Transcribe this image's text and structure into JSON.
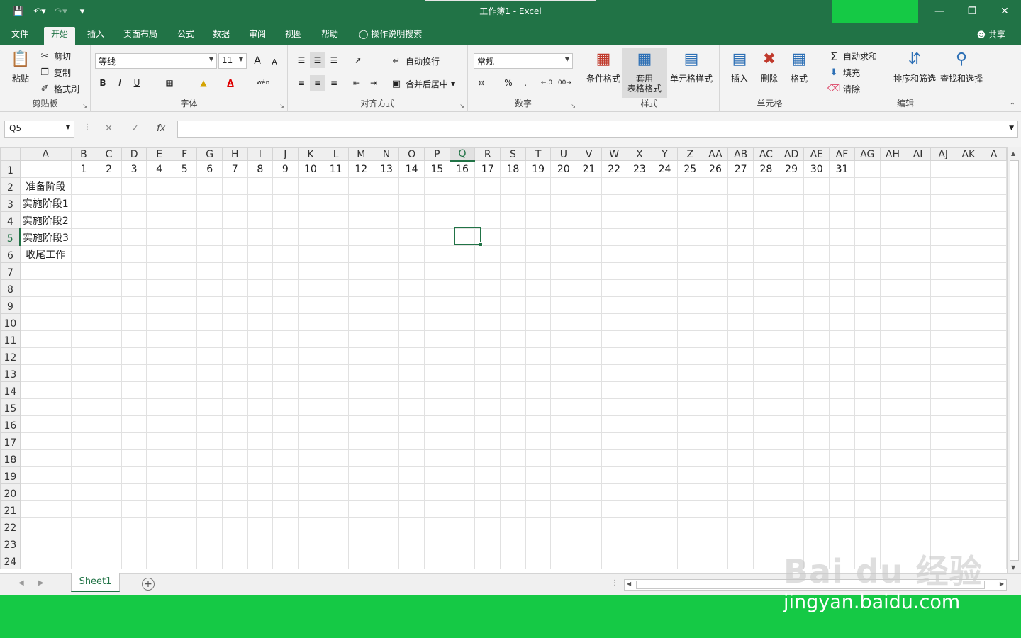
{
  "titlebar": {
    "title": "工作簿1  -  Excel",
    "qat": {
      "save_icon": "save-icon",
      "undo_icon": "undo-icon",
      "redo_icon": "redo-icon",
      "customize_icon": "customize-qat-icon"
    },
    "colors": {
      "excel_green": "#217346",
      "overlay_green": "#15c945"
    }
  },
  "tabs": {
    "items": [
      {
        "label": "文件"
      },
      {
        "label": "开始"
      },
      {
        "label": "插入"
      },
      {
        "label": "页面布局"
      },
      {
        "label": "公式"
      },
      {
        "label": "数据"
      },
      {
        "label": "审阅"
      },
      {
        "label": "视图"
      },
      {
        "label": "帮助"
      }
    ],
    "active": "开始",
    "tell_me": "操作说明搜索",
    "share": "共享"
  },
  "ribbon": {
    "clipboard": {
      "paste": "粘贴",
      "cut": "剪切",
      "copy": "复制",
      "format_painter": "格式刷",
      "label": "剪贴板"
    },
    "font": {
      "name": "等线",
      "size": "11",
      "label": "字体",
      "bold": "B",
      "italic": "I",
      "underline": "U",
      "grow": "A",
      "shrink": "A",
      "phonetic": "wén"
    },
    "alignment": {
      "wrap": "自动换行",
      "merge": "合并后居中",
      "label": "对齐方式"
    },
    "number": {
      "format": "常规",
      "label": "数字",
      "percent": "%",
      "comma": ","
    },
    "styles": {
      "conditional": "条件格式",
      "table_line1": "套用",
      "table_line2": "表格格式",
      "cell_styles": "单元格样式",
      "label": "样式"
    },
    "cells": {
      "insert": "插入",
      "delete": "删除",
      "format": "格式",
      "label": "单元格"
    },
    "editing": {
      "autosum": "自动求和",
      "fill": "填充",
      "clear": "清除",
      "sort": "排序和筛选",
      "find": "查找和选择",
      "label": "编辑"
    }
  },
  "formula_bar": {
    "name_box": "Q5",
    "cancel": "✕",
    "enter": "✓",
    "fx": "fx",
    "value": ""
  },
  "sheet": {
    "columns": [
      "A",
      "B",
      "C",
      "D",
      "E",
      "F",
      "G",
      "H",
      "I",
      "J",
      "K",
      "L",
      "M",
      "N",
      "O",
      "P",
      "Q",
      "R",
      "S",
      "T",
      "U",
      "V",
      "W",
      "X",
      "Y",
      "Z",
      "AA",
      "AB",
      "AC",
      "AD",
      "AE",
      "AF",
      "AG",
      "AH",
      "AI",
      "AJ",
      "AK",
      "A"
    ],
    "rows": [
      [
        "",
        "1",
        "2",
        "3",
        "4",
        "5",
        "6",
        "7",
        "8",
        "9",
        "10",
        "11",
        "12",
        "13",
        "14",
        "15",
        "16",
        "17",
        "18",
        "19",
        "20",
        "21",
        "22",
        "23",
        "24",
        "25",
        "26",
        "27",
        "28",
        "29",
        "30",
        "31",
        "",
        "",
        "",
        "",
        "",
        ""
      ],
      [
        "准备阶段"
      ],
      [
        "实施阶段1"
      ],
      [
        "实施阶段2"
      ],
      [
        "实施阶段3"
      ],
      [
        "收尾工作"
      ],
      [],
      [],
      [],
      [],
      [],
      [],
      [],
      [],
      [],
      [],
      [],
      [],
      [],
      [],
      [],
      [],
      [],
      []
    ],
    "row_numbers": [
      "1",
      "2",
      "3",
      "4",
      "5",
      "6",
      "7",
      "8",
      "9",
      "10",
      "11",
      "12",
      "13",
      "14",
      "15",
      "16",
      "17",
      "18",
      "19",
      "20",
      "21",
      "22",
      "23",
      "24"
    ],
    "selected_column": "Q",
    "selected_row": "5"
  },
  "sheet_tabs": {
    "items": [
      {
        "label": "Sheet1"
      }
    ],
    "add": "+"
  },
  "watermark": {
    "logo": "Bai du 经验",
    "url": "jingyan.baidu.com"
  }
}
